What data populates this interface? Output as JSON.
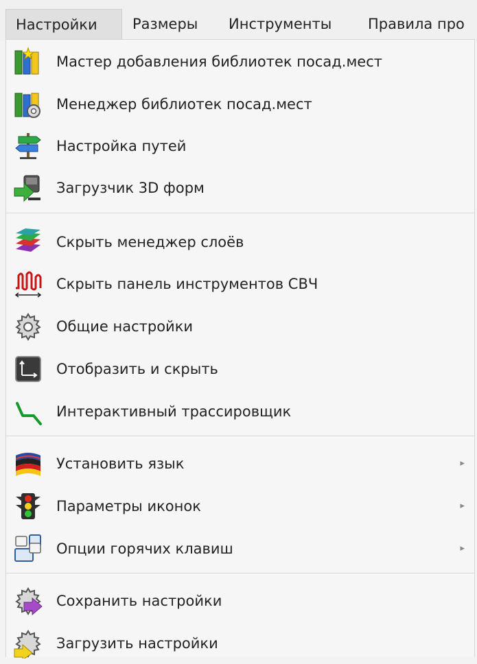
{
  "menubar": {
    "items": [
      {
        "label": "Настройки"
      },
      {
        "label": "Размеры"
      },
      {
        "label": "Инструменты"
      },
      {
        "label": "Правила про"
      }
    ]
  },
  "menu": {
    "items": [
      {
        "label": "Мастер добавления библиотек посад.мест",
        "icon": "footprint-library-wizard-icon"
      },
      {
        "label": "Менеджер библиотек посад.мест",
        "icon": "footprint-library-manager-icon"
      },
      {
        "label": "Настройка путей",
        "icon": "path-signpost-icon"
      },
      {
        "label": "Загрузчик 3D форм",
        "icon": "3d-shape-loader-icon"
      },
      {
        "label": "Скрыть менеджер слоёв",
        "icon": "layers-icon"
      },
      {
        "label": "Скрыть панель инструментов СВЧ",
        "icon": "microwave-toolbar-icon"
      },
      {
        "label": "Общие настройки",
        "icon": "gear-icon"
      },
      {
        "label": "Отобразить и скрыть",
        "icon": "display-options-icon"
      },
      {
        "label": "Интерактивный трассировщик",
        "icon": "interactive-router-icon"
      },
      {
        "label": "Установить язык",
        "icon": "language-flag-icon",
        "submenu": true
      },
      {
        "label": "Параметры иконок",
        "icon": "traffic-light-icon",
        "submenu": true
      },
      {
        "label": "Опции горячих клавиш",
        "icon": "hotkeys-icon",
        "submenu": true
      },
      {
        "label": "Сохранить настройки",
        "icon": "save-settings-icon"
      },
      {
        "label": "Загрузить настройки",
        "icon": "load-settings-icon"
      }
    ],
    "submenu_arrow": "▸"
  }
}
